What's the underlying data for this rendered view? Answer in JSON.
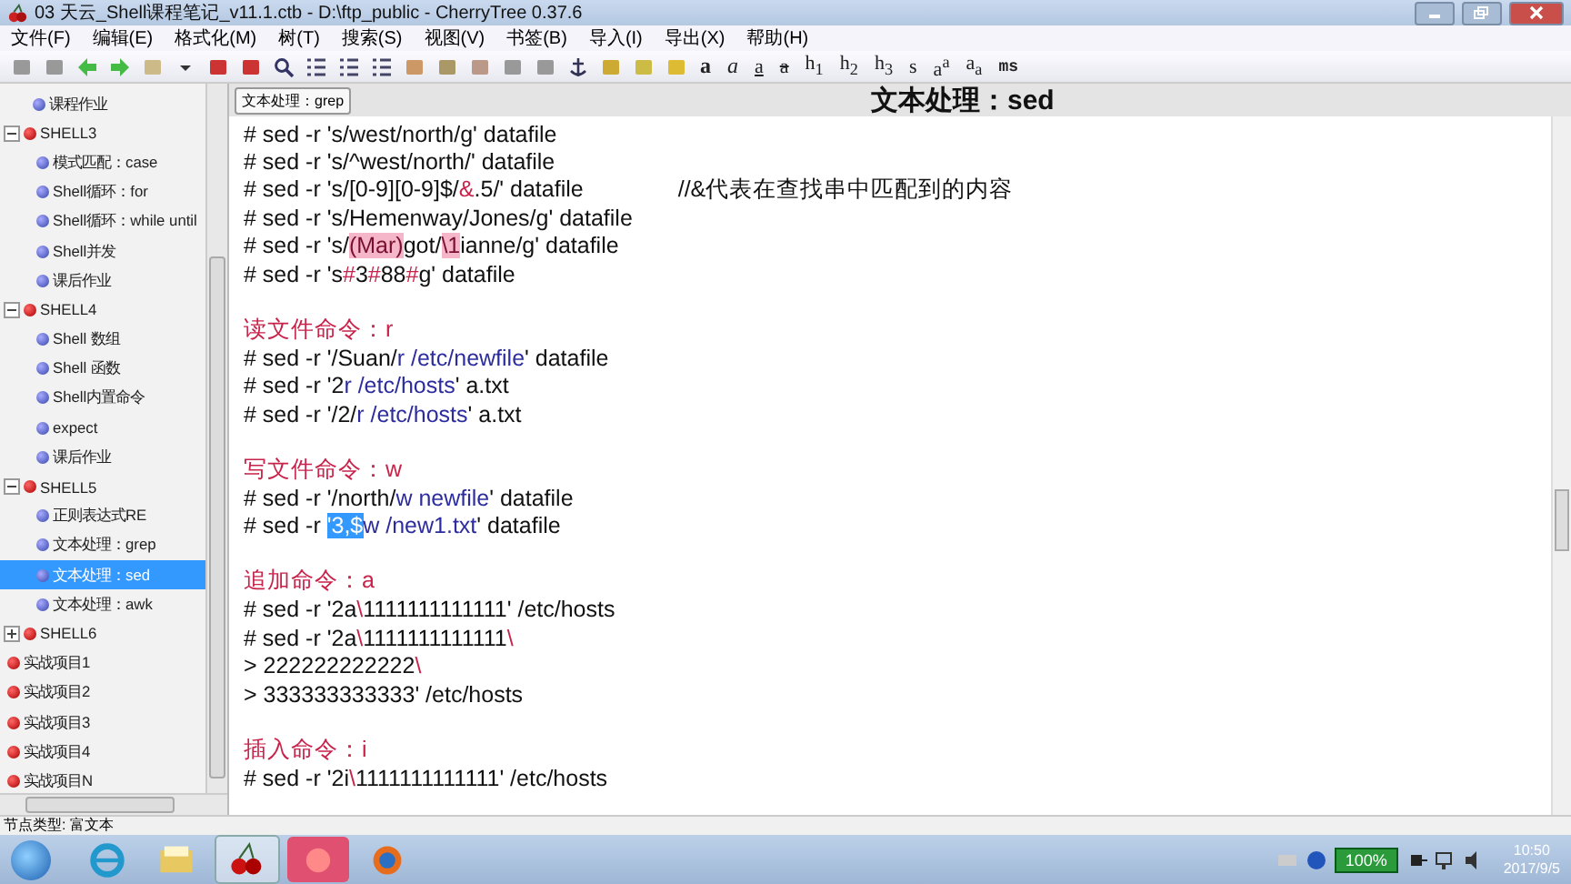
{
  "window": {
    "title": "03 天云_Shell课程笔记_v11.1.ctb - D:\\ftp_public - CherryTree 0.37.6"
  },
  "menu": [
    "文件(F)",
    "编辑(E)",
    "格式化(M)",
    "树(T)",
    "搜索(S)",
    "视图(V)",
    "书签(B)",
    "导入(I)",
    "导出(X)",
    "帮助(H)"
  ],
  "format_buttons": [
    {
      "label": "a",
      "kind": "bold"
    },
    {
      "label": "a",
      "kind": "italic"
    },
    {
      "label": "a",
      "kind": "underline"
    },
    {
      "label": "a",
      "kind": "strike"
    },
    {
      "label": "h$_{1}$",
      "kind": "plain"
    },
    {
      "label": "h$_{2}$",
      "kind": "plain"
    },
    {
      "label": "h$_{3}$",
      "kind": "plain"
    },
    {
      "label": "s",
      "kind": "small"
    },
    {
      "label": "a$^{a}$",
      "kind": "plain"
    },
    {
      "label": "a$_{a}$",
      "kind": "plain"
    },
    {
      "label": "ms",
      "kind": "mono"
    }
  ],
  "tree": [
    {
      "label": "课程作业",
      "kind": "page",
      "selected": false
    },
    {
      "label": "SHELL3",
      "kind": "node",
      "expanded": true,
      "selected": false,
      "children": [
        {
          "label": "模式匹配：case",
          "kind": "page",
          "selected": false
        },
        {
          "label": "Shell循环：for",
          "kind": "page",
          "selected": false
        },
        {
          "label": "Shell循环：while until",
          "kind": "page",
          "selected": false
        },
        {
          "label": "Shell并发",
          "kind": "page",
          "selected": false
        },
        {
          "label": "课后作业",
          "kind": "page",
          "selected": false
        }
      ]
    },
    {
      "label": "SHELL4",
      "kind": "node",
      "expanded": true,
      "selected": false,
      "children": [
        {
          "label": "Shell 数组",
          "kind": "page",
          "selected": false
        },
        {
          "label": "Shell 函数",
          "kind": "page",
          "selected": false
        },
        {
          "label": "Shell内置命令",
          "kind": "page",
          "selected": false
        },
        {
          "label": "expect",
          "kind": "page",
          "selected": false
        },
        {
          "label": "课后作业",
          "kind": "page",
          "selected": false
        }
      ]
    },
    {
      "label": "SHELL5",
      "kind": "node",
      "expanded": true,
      "selected": false,
      "children": [
        {
          "label": "正则表达式RE",
          "kind": "page",
          "selected": false
        },
        {
          "label": "文本处理：grep",
          "kind": "page",
          "selected": false
        },
        {
          "label": "文本处理：sed",
          "kind": "page",
          "selected": true
        },
        {
          "label": "文本处理：awk",
          "kind": "page",
          "selected": false
        }
      ]
    },
    {
      "label": "SHELL6",
      "kind": "node",
      "expanded": false,
      "selected": false
    },
    {
      "label": "实战项目1",
      "kind": "node",
      "selected": false
    },
    {
      "label": "实战项目2",
      "kind": "node",
      "selected": false
    },
    {
      "label": "实战项目3",
      "kind": "node",
      "selected": false
    },
    {
      "label": "实战项目4",
      "kind": "node",
      "selected": false
    },
    {
      "label": "实战项目N",
      "kind": "node",
      "selected": false
    }
  ],
  "tooltip": "文本处理：grep",
  "page_title": "文本处理：sed",
  "lines": [
    {
      "kind": "code",
      "segments": [
        {
          "text": "# sed -r 's/west/north/g' datafile",
          "kind": "plain"
        }
      ]
    },
    {
      "kind": "code",
      "segments": [
        {
          "text": "# sed -r 's/^west/north/' datafile",
          "kind": "plain"
        }
      ]
    },
    {
      "kind": "code",
      "segments": [
        {
          "text": "# sed -r 's/[0-9][0-9]$/",
          "kind": "plain"
        },
        {
          "text": "&",
          "kind": "red"
        },
        {
          "text": ".5/' datafile",
          "kind": "plain"
        }
      ],
      "comment": "//&代表在查找串中匹配到的内容"
    },
    {
      "kind": "code",
      "segments": [
        {
          "text": "# sed -r 's/Hemenway/Jones/g' datafile",
          "kind": "plain"
        }
      ]
    },
    {
      "kind": "code",
      "segments": [
        {
          "text": "# sed -r 's/",
          "kind": "plain"
        },
        {
          "text": "(Mar)",
          "kind": "mark"
        },
        {
          "text": "got/",
          "kind": "plain"
        },
        {
          "text": "\\1",
          "kind": "mark"
        },
        {
          "text": "ianne/g' datafile",
          "kind": "plain"
        }
      ]
    },
    {
      "kind": "code",
      "segments": [
        {
          "text": "# sed -r 's",
          "kind": "plain"
        },
        {
          "text": "#",
          "kind": "red"
        },
        {
          "text": "3",
          "kind": "plain"
        },
        {
          "text": "#",
          "kind": "red"
        },
        {
          "text": "88",
          "kind": "plain"
        },
        {
          "text": "#",
          "kind": "red"
        },
        {
          "text": "g' datafile",
          "kind": "plain"
        }
      ]
    },
    {
      "kind": "blank"
    },
    {
      "kind": "heading",
      "segments": [
        {
          "text": "读文件命令：r",
          "kind": "plain"
        }
      ]
    },
    {
      "kind": "code",
      "segments": [
        {
          "text": "# sed -r '/Suan/",
          "kind": "plain"
        },
        {
          "text": "r /etc/newfile",
          "kind": "blue"
        },
        {
          "text": "' datafile",
          "kind": "plain"
        }
      ]
    },
    {
      "kind": "code",
      "segments": [
        {
          "text": "# sed -r '2",
          "kind": "plain"
        },
        {
          "text": "r /etc/hosts",
          "kind": "blue"
        },
        {
          "text": "' a.txt",
          "kind": "plain"
        }
      ]
    },
    {
      "kind": "code",
      "segments": [
        {
          "text": "# sed -r '/2/",
          "kind": "plain"
        },
        {
          "text": "r /etc/hosts",
          "kind": "blue"
        },
        {
          "text": "' a.txt",
          "kind": "plain"
        }
      ]
    },
    {
      "kind": "blank"
    },
    {
      "kind": "heading",
      "segments": [
        {
          "text": "写文件命令：w",
          "kind": "plain"
        }
      ]
    },
    {
      "kind": "code",
      "segments": [
        {
          "text": "# sed -r '/north/",
          "kind": "plain"
        },
        {
          "text": "w newfile",
          "kind": "blue"
        },
        {
          "text": "' datafile",
          "kind": "plain"
        }
      ]
    },
    {
      "kind": "code",
      "segments": [
        {
          "text": "# sed -r ",
          "kind": "plain"
        },
        {
          "text": "'3,$",
          "kind": "sel"
        },
        {
          "text": "w /new1.txt",
          "kind": "blue"
        },
        {
          "text": "' datafile",
          "kind": "plain"
        }
      ]
    },
    {
      "kind": "blank"
    },
    {
      "kind": "heading",
      "segments": [
        {
          "text": "追加命令：a",
          "kind": "plain"
        }
      ]
    },
    {
      "kind": "code",
      "segments": [
        {
          "text": "# sed -r '2a",
          "kind": "plain"
        },
        {
          "text": "\\",
          "kind": "red"
        },
        {
          "text": "1111111111111' /etc/hosts",
          "kind": "plain"
        }
      ]
    },
    {
      "kind": "code",
      "segments": [
        {
          "text": "# sed -r '2a",
          "kind": "plain"
        },
        {
          "text": "\\",
          "kind": "red"
        },
        {
          "text": "1111111111111",
          "kind": "plain"
        },
        {
          "text": "\\",
          "kind": "red"
        }
      ]
    },
    {
      "kind": "code",
      "segments": [
        {
          "text": "> 222222222222",
          "kind": "plain"
        },
        {
          "text": "\\",
          "kind": "red"
        }
      ]
    },
    {
      "kind": "code",
      "segments": [
        {
          "text": "> 333333333333' /etc/hosts",
          "kind": "plain"
        }
      ]
    },
    {
      "kind": "blank"
    },
    {
      "kind": "heading",
      "segments": [
        {
          "text": "插入命令：i",
          "kind": "plain"
        }
      ]
    },
    {
      "kind": "code",
      "segments": [
        {
          "text": "# sed -r '2i",
          "kind": "plain"
        },
        {
          "text": "\\",
          "kind": "red"
        },
        {
          "text": "1111111111111' /etc/hosts",
          "kind": "plain"
        }
      ]
    }
  ],
  "status_bar": "节点类型: 富文本",
  "taskbar": {
    "battery": "100%",
    "time": "10:50",
    "date": "2017/9/5"
  }
}
